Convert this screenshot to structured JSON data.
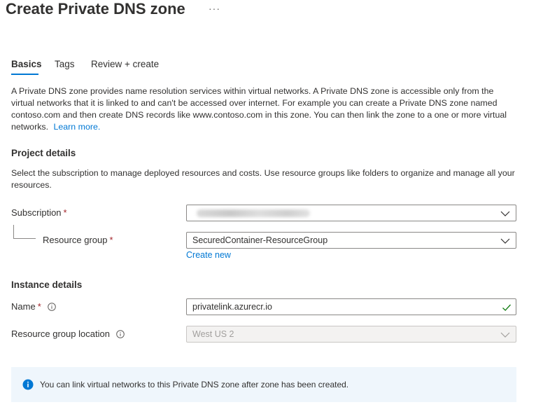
{
  "header": {
    "title": "Create Private DNS zone",
    "more_label": "···"
  },
  "tabs": [
    {
      "label": "Basics",
      "active": true
    },
    {
      "label": "Tags",
      "active": false
    },
    {
      "label": "Review + create",
      "active": false
    }
  ],
  "intro": {
    "text": "A Private DNS zone provides name resolution services within virtual networks. A Private DNS zone is accessible only from the virtual networks that it is linked to and can't be accessed over internet. For example you can create a Private DNS zone named contoso.com and then create DNS records like www.contoso.com in this zone. You can then link the zone to a one or more virtual networks.",
    "learn_more": "Learn more."
  },
  "project_details": {
    "heading": "Project details",
    "description": "Select the subscription to manage deployed resources and costs. Use resource groups like folders to organize and manage all your resources.",
    "subscription": {
      "label": "Subscription",
      "required_mark": "*"
    },
    "resource_group": {
      "label": "Resource group",
      "required_mark": "*",
      "value": "SecuredContainer-ResourceGroup",
      "create_new": "Create new"
    }
  },
  "instance_details": {
    "heading": "Instance details",
    "name": {
      "label": "Name",
      "required_mark": "*",
      "value": "privatelink.azurecr.io",
      "valid": true
    },
    "location": {
      "label": "Resource group location",
      "value": "West US 2",
      "disabled": true
    }
  },
  "info_bar": {
    "text": "You can link virtual networks to this Private DNS zone after zone has been created."
  },
  "icons": {
    "info": "info-icon",
    "chevron": "chevron-down-icon",
    "check": "checkmark-icon"
  },
  "colors": {
    "accent": "#0078d4",
    "required": "#a4262c",
    "valid": "#107c10",
    "info_bar_bg": "#eff6fc"
  }
}
